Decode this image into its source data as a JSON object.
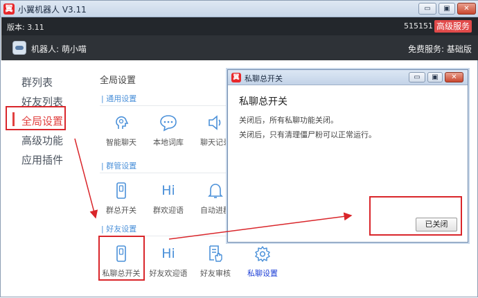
{
  "window": {
    "title": "小翼机器人 V3.11",
    "logo": "翼",
    "min_label": "▭",
    "max_label": "▣",
    "close_label": "✕"
  },
  "header": {
    "version": "版本: 3.11",
    "account": "515151",
    "premium_label": "高级服务"
  },
  "bot": {
    "name": "机器人: 萌小喵",
    "service": "免费服务: 基础版"
  },
  "nav": {
    "items": [
      "群列表",
      "好友列表",
      "全局设置",
      "高级功能",
      "应用插件"
    ],
    "active_index": 2
  },
  "content": {
    "title": "全局设置",
    "sections": [
      {
        "label": "| 通用设置",
        "tiles": [
          {
            "label": "智能聊天",
            "icon": "brain-icon"
          },
          {
            "label": "本地词库",
            "icon": "chat-bubble-icon"
          },
          {
            "label": "聊天记录",
            "icon": "speaker-icon"
          }
        ]
      },
      {
        "label": "| 群管设置",
        "tiles": [
          {
            "label": "群总开关",
            "icon": "switch-icon"
          },
          {
            "label": "群欢迎语",
            "icon": "hi-icon",
            "glyph": "Hi"
          },
          {
            "label": "自动进群",
            "icon": "bell-icon"
          }
        ]
      },
      {
        "label": "| 好友设置",
        "tiles": [
          {
            "label": "私聊总开关",
            "icon": "switch-icon"
          },
          {
            "label": "好友欢迎语",
            "icon": "hi-icon",
            "glyph": "Hi"
          },
          {
            "label": "好友审核",
            "icon": "document-hand-icon"
          },
          {
            "label": "私聊设置",
            "icon": "gear-icon"
          }
        ]
      }
    ]
  },
  "dialog": {
    "title": "私聊总开关",
    "heading": "私聊总开关",
    "lines": [
      "关闭后，所有私聊功能关闭。",
      "关闭后，只有清理僵尸粉可以正常运行。"
    ],
    "button_label": "已关闭"
  },
  "colors": {
    "accent": "#e1403f",
    "link": "#1d3fd6",
    "icon": "#4a90d9",
    "header_bg": "#23272c"
  }
}
